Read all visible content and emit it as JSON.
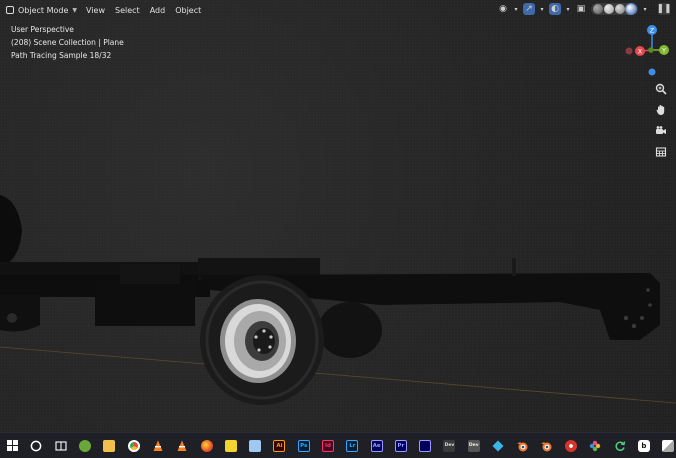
{
  "header": {
    "mode": "Object Mode",
    "menus": [
      "View",
      "Select",
      "Add",
      "Object"
    ]
  },
  "overlay": {
    "line1": "User Perspective",
    "line2": "(208) Scene Collection | Plane",
    "line3": "Path Tracing Sample 18/32"
  },
  "gizmo": {
    "z": "Z",
    "x": "X",
    "y": "Y"
  },
  "colors": {
    "axis_x": "#e5484d",
    "axis_y": "#83b82f",
    "axis_z": "#3d8fe8",
    "active_blue": "#3f69a8",
    "viewport_bg": "#262626",
    "taskbar_bg": "#1f2026"
  },
  "taskbar": {
    "apps": [
      {
        "icon": "windows-start-icon"
      },
      {
        "icon": "search-circle-icon"
      },
      {
        "icon": "task-view-icon"
      },
      {
        "icon": "app-green-icon"
      },
      {
        "icon": "file-explorer-icon"
      },
      {
        "icon": "chrome-icon"
      },
      {
        "icon": "vlc-icon"
      },
      {
        "icon": "vlc-icon"
      },
      {
        "icon": "firefox-icon"
      },
      {
        "icon": "sticky-notes-icon"
      },
      {
        "icon": "app-blue-icon"
      },
      {
        "icon": "illustrator-icon",
        "label": "Ai"
      },
      {
        "icon": "photoshop-icon",
        "label": "Ps"
      },
      {
        "icon": "indesign-icon",
        "label": "Id"
      },
      {
        "icon": "lightroom-icon",
        "label": "Lr"
      },
      {
        "icon": "after-effects-icon",
        "label": "Ae"
      },
      {
        "icon": "premiere-icon",
        "label": "Pr"
      },
      {
        "icon": "media-encoder-icon"
      },
      {
        "icon": "app-dev-icon",
        "label": "Dev"
      },
      {
        "icon": "app-dev2-icon",
        "label": "Dev"
      },
      {
        "icon": "app-diamond-icon"
      },
      {
        "icon": "blender-icon"
      },
      {
        "icon": "blender-icon"
      },
      {
        "icon": "app-red-icon"
      },
      {
        "icon": "app-flower-icon"
      },
      {
        "icon": "refresh-icon"
      },
      {
        "icon": "app-b-icon"
      },
      {
        "icon": "app-white-icon"
      }
    ]
  }
}
